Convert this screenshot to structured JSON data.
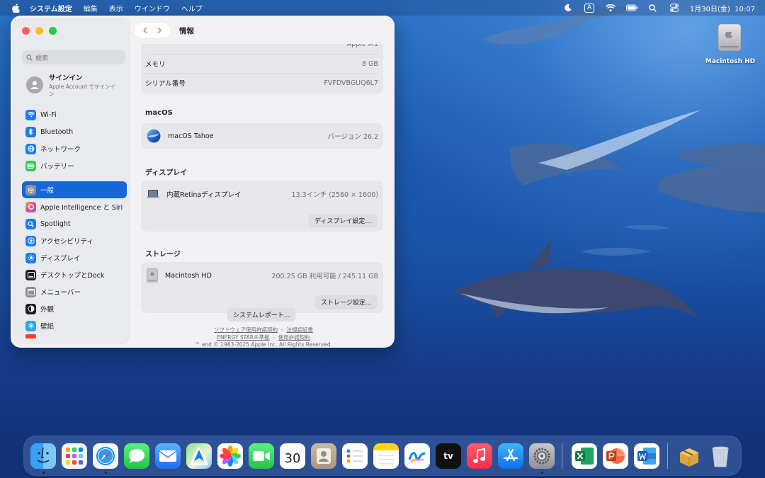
{
  "menubar": {
    "app_name": "システム設定",
    "menus": [
      "編集",
      "表示",
      "ウインドウ",
      "ヘルプ"
    ],
    "input_method": "A",
    "clock": "1月30日(金)  10:07"
  },
  "desktop": {
    "hd_label": "Macintosh HD"
  },
  "sidebar": {
    "search_placeholder": "検索",
    "signin_title": "サインイン",
    "signin_sub": "Apple Account でサインイン",
    "items": [
      {
        "label": "Wi-Fi",
        "icon": "wifi-icon",
        "color": "#1a7cf0"
      },
      {
        "label": "Bluetooth",
        "icon": "bluetooth-icon",
        "color": "#1a7cf0"
      },
      {
        "label": "ネットワーク",
        "icon": "globe-icon",
        "color": "#1a7cf0"
      },
      {
        "label": "バッテリー",
        "icon": "battery-icon",
        "color": "#34c759"
      },
      {
        "label": "一般",
        "icon": "gear-icon",
        "color": "#8e8e93"
      },
      {
        "label": "Apple Intelligence と Siri",
        "icon": "siri-icon",
        "color": "#e0508a"
      },
      {
        "label": "Spotlight",
        "icon": "magnifier-icon",
        "color": "#1a7cf0"
      },
      {
        "label": "アクセシビリティ",
        "icon": "accessibility-icon",
        "color": "#1a7cf0"
      },
      {
        "label": "ディスプレイ",
        "icon": "sun-icon",
        "color": "#1a7cf0"
      },
      {
        "label": "デスクトップとDock",
        "icon": "dock-icon",
        "color": "#1d1d1f"
      },
      {
        "label": "メニューバー",
        "icon": "menubar-icon",
        "color": "#8e8e93"
      },
      {
        "label": "外観",
        "icon": "appearance-icon",
        "color": "#1d1d1f"
      },
      {
        "label": "壁紙",
        "icon": "snowflake-icon",
        "color": "#2aa7e8"
      }
    ]
  },
  "content": {
    "title": "情報",
    "partial_row_value": "Apple M1",
    "specs": [
      {
        "key": "メモリ",
        "value": "8 GB"
      },
      {
        "key": "シリアル番号",
        "value": "FVFDVBGUQ6L7"
      }
    ],
    "macos_section": "macOS",
    "macos_name": "macOS Tahoe",
    "macos_version": "バージョン 26.2",
    "display_section": "ディスプレイ",
    "display_name": "内蔵Retinaディスプレイ",
    "display_spec": "13.3インチ (2560 × 1600)",
    "display_button": "ディスプレイ設定...",
    "storage_section": "ストレージ",
    "storage_name": "Macintosh HD",
    "storage_value": "200.25 GB 利用可能 / 245.11 GB",
    "storage_button": "ストレージ設定...",
    "report_button": "システムレポート...",
    "footer_link1": "ソフトウェア使用許諾契約",
    "footer_sep": "-",
    "footer_link2": "法規認証書",
    "footer_link3": "ENERGY STAR®準拠",
    "footer_link4": "使用許諾契約",
    "footer_copyright": "™ and © 1983-2025 Apple Inc. All Rights Reserved."
  },
  "dock": {
    "calendar_day": "30",
    "tv_label": "tv",
    "apps": [
      "finder-icon",
      "launchpad-icon",
      "safari-icon",
      "messages-icon",
      "mail-icon",
      "maps-icon",
      "photos-icon",
      "facetime-icon",
      "calendar-icon",
      "contacts-icon",
      "reminders-icon",
      "notes-icon",
      "freeform-icon",
      "appletv-icon",
      "music-icon",
      "appstore-icon",
      "system-settings-icon",
      "excel-icon",
      "powerpoint-icon",
      "word-icon",
      "installer-icon",
      "trash-icon"
    ]
  }
}
